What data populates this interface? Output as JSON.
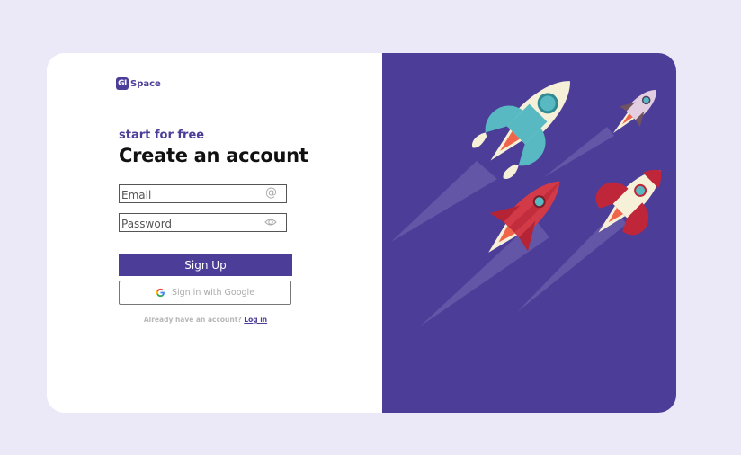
{
  "brand": {
    "badge": "GI",
    "name": "Space"
  },
  "form": {
    "subtitle": "start for free",
    "title": "Create an account",
    "email_placeholder": "Email",
    "password_placeholder": "Password",
    "email_icon": "at-icon",
    "password_icon": "eye-icon",
    "signup_label": "Sign Up",
    "google_label": "Sign in with Google",
    "login_prompt": "Already have an account?",
    "login_link": "Log in"
  },
  "colors": {
    "page_bg": "#ebe9f8",
    "panel_bg": "#4c3d99",
    "accent": "#4c3d99",
    "rocket_red": "#c0263a",
    "rocket_teal": "#58b9c2",
    "rocket_cream": "#f6f0d8",
    "flame_orange": "#f0654a"
  },
  "illustration": {
    "name": "rockets-illustration",
    "rocket_count": 4
  }
}
